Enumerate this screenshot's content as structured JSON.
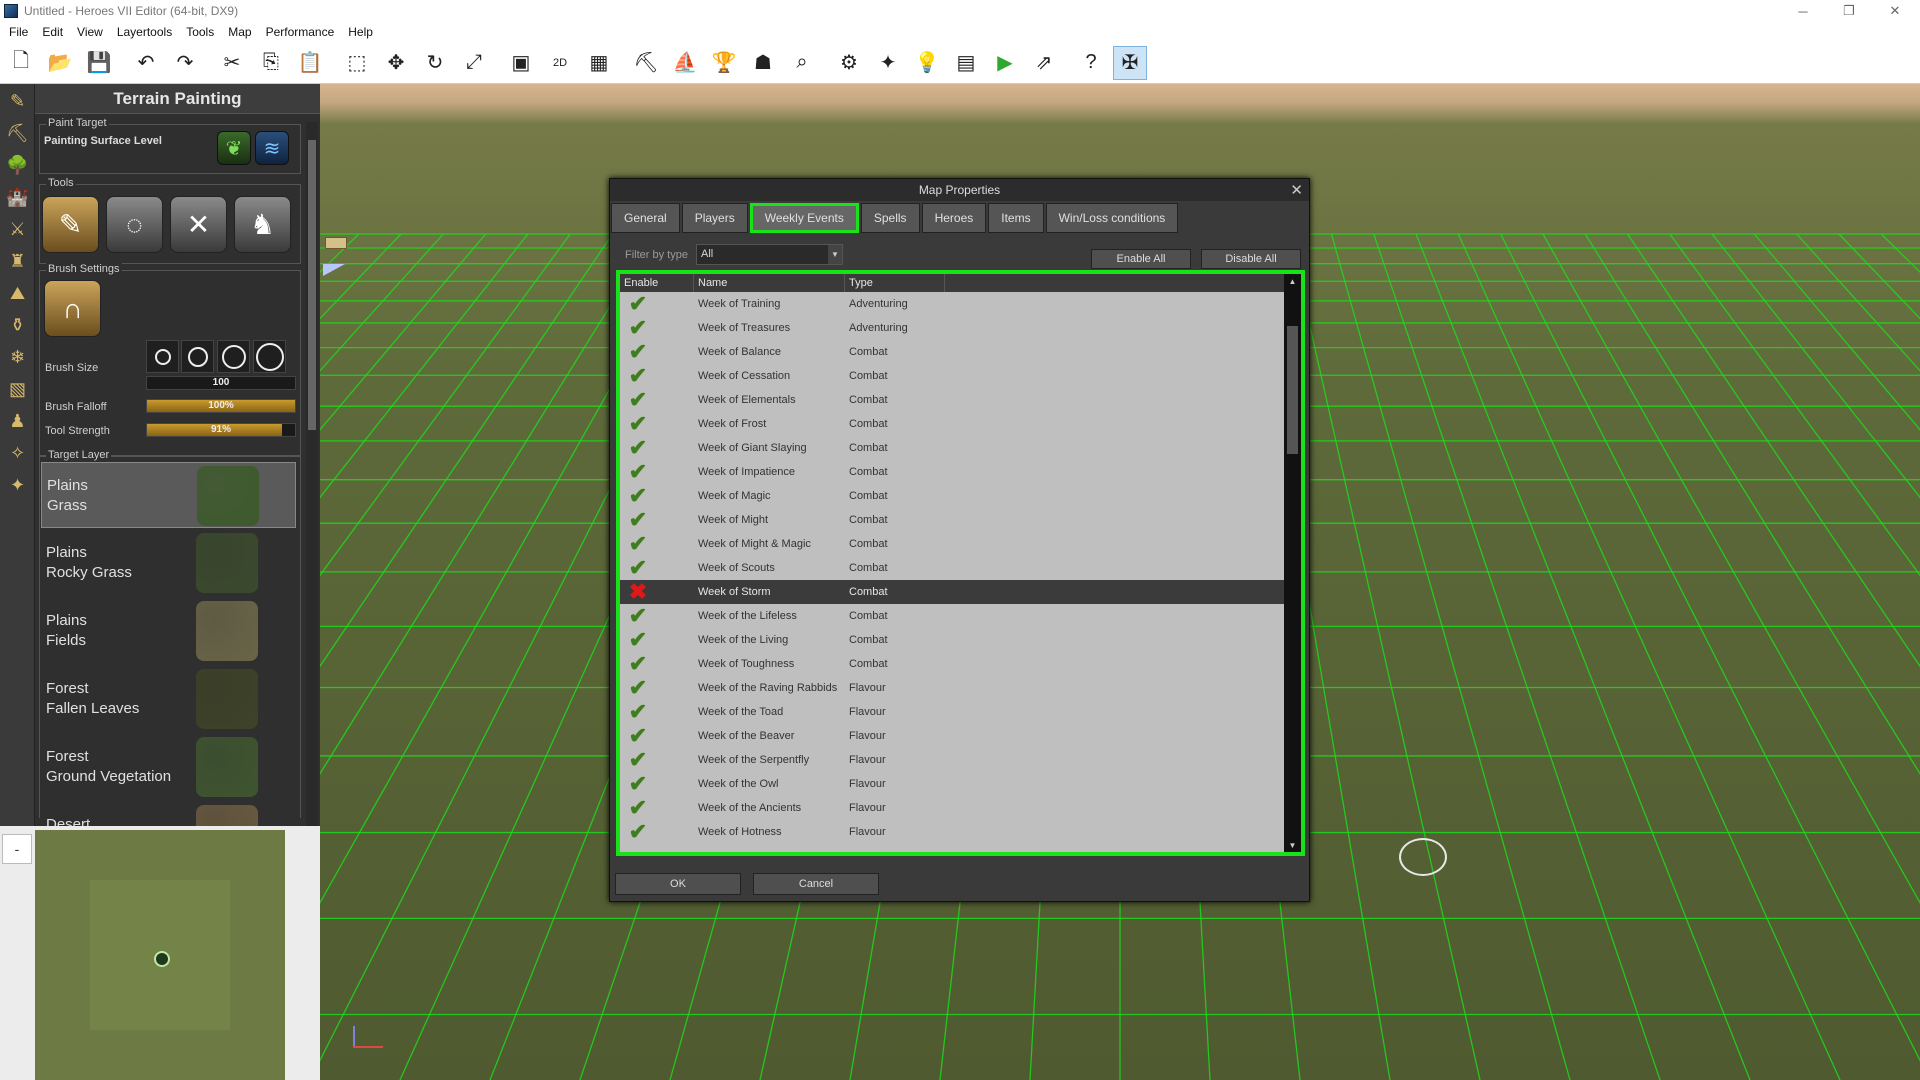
{
  "window": {
    "title": "Untitled - Heroes VII Editor (64-bit, DX9)",
    "minimize": "─",
    "restore": "❐",
    "close": "✕"
  },
  "menu": [
    "File",
    "Edit",
    "View",
    "Layertools",
    "Tools",
    "Map",
    "Performance",
    "Help"
  ],
  "toolbar": [
    {
      "name": "new-file",
      "glyph": "🗋"
    },
    {
      "name": "open-folder",
      "glyph": "📂"
    },
    {
      "name": "save",
      "glyph": "💾"
    },
    {
      "sep": true
    },
    {
      "name": "undo",
      "glyph": "↶"
    },
    {
      "name": "redo",
      "glyph": "↷"
    },
    {
      "sep": true
    },
    {
      "name": "cut",
      "glyph": "✂"
    },
    {
      "name": "copy",
      "glyph": "⎘"
    },
    {
      "name": "paste",
      "glyph": "📋"
    },
    {
      "sep": true
    },
    {
      "name": "select",
      "glyph": "⬚"
    },
    {
      "name": "move",
      "glyph": "✥"
    },
    {
      "name": "rotate",
      "glyph": "↻"
    },
    {
      "name": "scale",
      "glyph": "⤢"
    },
    {
      "sep": true
    },
    {
      "name": "camera",
      "glyph": "▣"
    },
    {
      "name": "2d-view",
      "glyph": "2D"
    },
    {
      "name": "grid",
      "glyph": "▦"
    },
    {
      "sep": true
    },
    {
      "name": "tool-a",
      "glyph": "⛏"
    },
    {
      "name": "tool-b",
      "glyph": "⛵"
    },
    {
      "name": "trophy",
      "glyph": "🏆"
    },
    {
      "name": "ghost",
      "glyph": "☗"
    },
    {
      "name": "search-map",
      "glyph": "⌕"
    },
    {
      "sep": true
    },
    {
      "name": "gears",
      "glyph": "⚙"
    },
    {
      "name": "compass",
      "glyph": "✦"
    },
    {
      "name": "lightbulb",
      "glyph": "💡"
    },
    {
      "name": "script",
      "glyph": "▤"
    },
    {
      "name": "play",
      "glyph": "▶"
    },
    {
      "name": "export",
      "glyph": "⇗"
    },
    {
      "sep": true
    },
    {
      "name": "help",
      "glyph": "?"
    },
    {
      "name": "map-properties",
      "glyph": "✠",
      "active": true
    }
  ],
  "panel": {
    "title": "Terrain Painting",
    "paint_target_label": "Paint Target",
    "painting_surface_level": "Painting Surface Level",
    "tools_label": "Tools",
    "brush_settings_label": "Brush Settings",
    "brush_size_label": "Brush Size",
    "brush_size_value": "100",
    "brush_falloff_label": "Brush Falloff",
    "brush_falloff_value": "100%",
    "brush_falloff_fraction": 1.0,
    "tool_strength_label": "Tool Strength",
    "tool_strength_value": "91%",
    "tool_strength_fraction": 0.91,
    "target_layer_label": "Target Layer",
    "layers": [
      {
        "line1": "Plains",
        "line2": "Grass",
        "selected": true,
        "color": "#3e5a2c"
      },
      {
        "line1": "Plains",
        "line2": "Rocky Grass",
        "selected": false,
        "color": "#3b4a2e"
      },
      {
        "line1": "Plains",
        "line2": "Fields",
        "selected": false,
        "color": "#6a6548"
      },
      {
        "line1": "Forest",
        "line2": "Fallen Leaves",
        "selected": false,
        "color": "#3e4227"
      },
      {
        "line1": "Forest",
        "line2": "Ground Vegetation",
        "selected": false,
        "color": "#3f5530"
      },
      {
        "line1": "Desert",
        "line2": "",
        "selected": false,
        "color": "#6a5a40"
      }
    ]
  },
  "minimap": {
    "collapse": "-"
  },
  "dialog": {
    "title": "Map Properties",
    "close": "✕",
    "tabs": [
      {
        "label": "General",
        "active": false
      },
      {
        "label": "Players",
        "active": false
      },
      {
        "label": "Weekly Events",
        "active": true
      },
      {
        "label": "Spells",
        "active": false
      },
      {
        "label": "Heroes",
        "active": false
      },
      {
        "label": "Items",
        "active": false
      },
      {
        "label": "Win/Loss conditions",
        "active": false
      }
    ],
    "filter_label": "Filter by type",
    "filter_value": "All",
    "enable_all": "Enable All",
    "disable_all": "Disable All",
    "columns": [
      "Enable",
      "Name",
      "Type"
    ],
    "rows": [
      {
        "enabled": true,
        "name": "Week of Training",
        "type": "Adventuring"
      },
      {
        "enabled": true,
        "name": "Week of Treasures",
        "type": "Adventuring"
      },
      {
        "enabled": true,
        "name": "Week of Balance",
        "type": "Combat"
      },
      {
        "enabled": true,
        "name": "Week of Cessation",
        "type": "Combat"
      },
      {
        "enabled": true,
        "name": "Week of Elementals",
        "type": "Combat"
      },
      {
        "enabled": true,
        "name": "Week of Frost",
        "type": "Combat"
      },
      {
        "enabled": true,
        "name": "Week of Giant Slaying",
        "type": "Combat"
      },
      {
        "enabled": true,
        "name": "Week of Impatience",
        "type": "Combat"
      },
      {
        "enabled": true,
        "name": "Week of Magic",
        "type": "Combat"
      },
      {
        "enabled": true,
        "name": "Week of Might",
        "type": "Combat"
      },
      {
        "enabled": true,
        "name": "Week of Might & Magic",
        "type": "Combat"
      },
      {
        "enabled": true,
        "name": "Week of Scouts",
        "type": "Combat"
      },
      {
        "enabled": false,
        "name": "Week of Storm",
        "type": "Combat",
        "selected": true
      },
      {
        "enabled": true,
        "name": "Week of the Lifeless",
        "type": "Combat"
      },
      {
        "enabled": true,
        "name": "Week of the Living",
        "type": "Combat"
      },
      {
        "enabled": true,
        "name": "Week of Toughness",
        "type": "Combat"
      },
      {
        "enabled": true,
        "name": "Week of the Raving Rabbids",
        "type": "Flavour"
      },
      {
        "enabled": true,
        "name": "Week of the Toad",
        "type": "Flavour"
      },
      {
        "enabled": true,
        "name": "Week of the Beaver",
        "type": "Flavour"
      },
      {
        "enabled": true,
        "name": "Week of the Serpentfly",
        "type": "Flavour"
      },
      {
        "enabled": true,
        "name": "Week of the Owl",
        "type": "Flavour"
      },
      {
        "enabled": true,
        "name": "Week of the Ancients",
        "type": "Flavour"
      },
      {
        "enabled": true,
        "name": "Week of Hotness",
        "type": "Flavour"
      }
    ],
    "ok": "OK",
    "cancel": "Cancel"
  },
  "colors": {
    "highlight": "#19e219",
    "check": "#3f7d1e",
    "cross": "#e01818"
  }
}
